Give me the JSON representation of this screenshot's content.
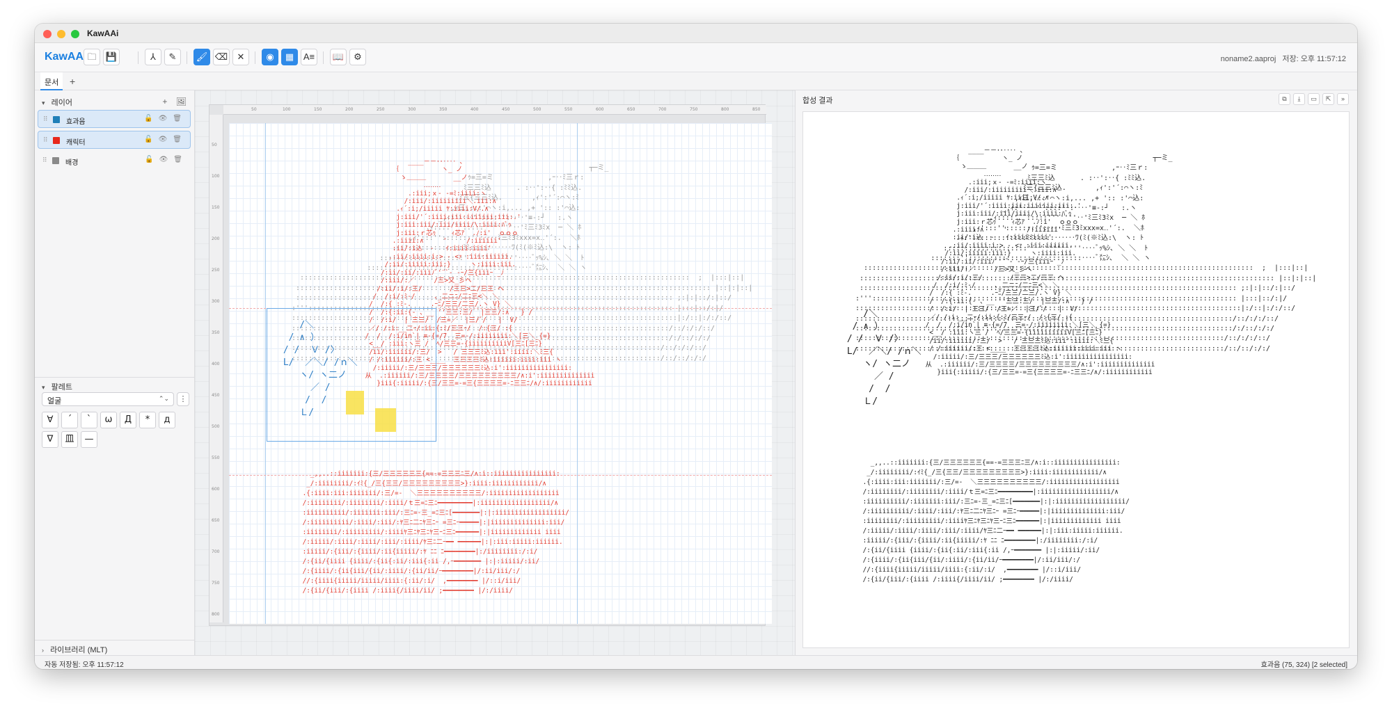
{
  "window": {
    "title": "KawAAi"
  },
  "toolbar": {
    "brand": "KawAAi",
    "buttons": [
      {
        "name": "open-folder-button",
        "icon": "folder-icon",
        "glyph": "🗀",
        "active": false
      },
      {
        "name": "save-button",
        "icon": "floppy-icon",
        "glyph": "💾",
        "active": false
      },
      {
        "name": "path-tool-button",
        "icon": "path-icon",
        "glyph": "⅄",
        "active": false
      },
      {
        "name": "pen-tool-button",
        "icon": "pen-icon",
        "glyph": "✎",
        "active": false
      },
      {
        "name": "brush-tool-button",
        "icon": "brush-icon",
        "glyph": "🖌",
        "active": true
      },
      {
        "name": "eraser-tool-button",
        "icon": "eraser-icon",
        "glyph": "⌫",
        "active": false
      },
      {
        "name": "clear-button",
        "icon": "close-icon",
        "glyph": "✕",
        "active": false
      },
      {
        "name": "snap-toggle-button",
        "icon": "magnet-icon",
        "glyph": "◉",
        "active": true
      },
      {
        "name": "grid-toggle-button",
        "icon": "grid-icon",
        "glyph": "▦",
        "active": true
      },
      {
        "name": "text-layout-button",
        "icon": "text-align-icon",
        "glyph": "A≡",
        "active": false
      },
      {
        "name": "book-button",
        "icon": "book-icon",
        "glyph": "📖",
        "active": false
      },
      {
        "name": "settings-button",
        "icon": "gear-icon",
        "glyph": "⚙",
        "active": false
      }
    ],
    "filename": "noname2.aaproj",
    "saved_status": "저장: 오후 11:57:12"
  },
  "tabs": {
    "doc_tab": "문서",
    "add_tab": "+"
  },
  "layers_panel": {
    "title": "레이어",
    "add_icon": "+",
    "image_icon": "🖼",
    "layers": [
      {
        "name": "효과음",
        "color": "#1f7fb8",
        "selected": true
      },
      {
        "name": "캐릭터",
        "color": "#e8281c",
        "selected": true
      },
      {
        "name": "배경",
        "color": "#8a8a8a",
        "selected": false
      }
    ],
    "layer_icons": {
      "lock": "🔓",
      "eye": "👁",
      "trash": "🗑"
    }
  },
  "palette_panel": {
    "title": "팔레트",
    "selected_set": "얼굴",
    "more_icon": "⋮",
    "glyphs": [
      "∀",
      "´",
      "`",
      "ω",
      "Д",
      "*",
      "д",
      "∇",
      "皿",
      "—"
    ]
  },
  "library_panel": {
    "title": "라이브러리 (MLT)"
  },
  "canvas": {
    "ruler_x": [
      "50",
      "100",
      "150",
      "200",
      "250",
      "300",
      "350",
      "400",
      "450",
      "500",
      "550",
      "600",
      "650",
      "700",
      "750",
      "800",
      "850"
    ],
    "ruler_y": [
      "50",
      "100",
      "150",
      "200",
      "250",
      "300",
      "350",
      "400",
      "450",
      "500",
      "550",
      "600",
      "650",
      "700",
      "750",
      "800"
    ],
    "effect_text": "    /＼\n  / ∧ ）\n / /  Ｖ /〉\n L/  ／＼/ /ｎ＼\n    ヽ/ ヽ二ノ\n      ／ /\n     /  /\n    Ｌ/",
    "character_text": "            ____－－･･‥‥ ､\n        ｛           ヽ_ ノ\n          ゝ＿＿＿       __ノ\n                ‥‥‥‥\n            .:iii;ｘ- -=ﾐ:iiii:ヽ\n           /:iii/:iiiiiiiii＼.iii:∧\n         .ｨ´:i;/iiiii ﾔ:iiii:V/.∧\n         j:iii/'´:iiii:iii:iiiiiii:iii:.'\n         j:iii:iii/:iii/iiii/\\:iiii:ﾊﾞｩ\n         j:iii:ｒ芯ｩ    ｨ芯ｱ  .ﾉ:i'  ｏｏｏ\n        .:iiii:∧     '     /:iiiiii'\n        :ii/:i込  -   ｲ:iiii:iiii'\n       .:ii/:iiii:i:> - <ｧ :iii:iiiiii.\n      /:ii/:iiiii:iii:}     ヽ:iiii:iii.\n     /:ii/:ii/:iiiﾉﾞ'¨ﾞ- -ｰ/三{iiiｰ _ﾉ\n     /:iii/:／     /三>又_彡ヘ\n    /:ii/:i/:三/       /三三>二/三三 ヘ\n   /  /:i/:ﾐ-/     ､_二ニﾆ/二ﾆ三<＼ ＼\n  /  /:{ :ﾐ-.     .ｰﾆ/三三/二三/.ヽ V} ＼\n  /  /:{:ii:{- 、__ ''三三:三/  |三三/:∧   } /\n  /  /:i/  | 三三/  /三=／  |三/ﾞ/   |  V/\n  ／/ /:i:__二ｰ/:ii:{:ﾐ/三三ｰ/  /:{三/ :{  \n /  /  /:i/in`| ≡-{=/7  三=-/:iiiiiiii:＼[三＼_{=}\n  <__/ :iii:ヽ三 /  ﾍ/三三=-{iiiiiiiiiiV[三ﾆ[三ﾆ}\n  /ii/:iiiiii/:三/  >   / 三三三ﾐ込:iii':iiii:＼ﾐ三{\n  / /:iiiiii/:三 <____  三三三三ﾐ込:iiiiii:iiii:iii ヽ\n   /:iiiii/:三/三三三/三三三三三三ﾐ込:i':iiiiiiiiiiiiiiii:\n 从  .:iiiiii/:三/三三三三/三三三三三三三三三/∧:i':iiiiiiiiiiiiii\n    }iii{:iiiii/:{三/三三=-=三{三三三三=-ﾆ三三ﾆ/∧/:iiiiiiiiiiii",
    "background_text": "                                                                       ┬─ミ_\n                                          ｩ=三=ミ             ,ｰ‥ﾐ三ｒ:\n                                         ﾐ三三ﾐ込      . :‥':‥{ :ﾐﾐ込.\n                                       .ﾐ三{三三ﾐ込.       ,ｨ':'´:⌒ヽ:ﾐ\n                                      ,ｨ三,:::'⌒ヽ:i,... ,+ ':: :'⌒込:\n                                   _,ｨ:'‥‥'´::::'':‥‥'≡-:┘   :.ヽ\n                                .ｨ::::'¨¨:::::'''''''‥'ﾐ三ﾐ3ﾐx  ─ ＼ ﾎ\n                            ,ｨ':::'':::::::'':‥‥ﾐ三ﾐ3ﾐxxx=x‥'´:.  ＼ﾎ\n                        .ｨ:':::::::::::::ﾐﾐ:::::‥‥‥ﾜ(ﾐ(※ﾐ込:\\  ヽ: ﾄ\n                     ::::::::::::::::::::'´ ''''''''''‥‥ﾞｯ%ｼ､ ＼ ＼  ﾄ\n                  :::::::'':::::::::::::::::::::::::::‥‥ﾞ㍍ｼ､  ＼ ＼ ヽ \n  :::::::::::::::::::::::::::::::::::::::::::::::::::::::::::::::::::::::::::::::::::::::::::::  ;  |:::|::|\n ::::::::::::::::::::::::::::::::::::::::::::::::::::::::::::::::::::::::::::::::::::::::::::::::::: |::|:|::|\n :::::::::::::::::::::::::::::::::::::::::::::::::::::::::::::::::::::::::::::::::::::::::: ;:|:|::/:|::/\n:'''::::::::::::::::::::::::::::::::::::::::::::::::::::::::::::::::::::::::::::::::::::::: |:::|::/:|/\n::::::::::::::::::::::::::::::::::::::::::::::::::::::::::::::::::::::::::::::::::::::::::::|:/::|:/:/::/\n::::::::::::::::::::::::::::::::::::::::::::::::::::::::::::::::::::::::::::::::::::::::::/::/:/:/::/\n::::::::::::::::::::::::::::::::::::::::::::::::::::::::::::::::::::::::::::::::::::::::::/:/::/:/:/\n::::::::::::::::::::::::::::::::::::::::::::::::::::::::::::::::::::::::::::::::::::::::/::/:/:/::/\n::::::::::::::::::::::::::::::::::::::::::::::::::::::::::::::::::::::::::::::::::::::::/::/::/:/:/",
    "lower_red_text": "   _,,..::iiiiiii:{三/三三三三三三{==-=三三三ﾆ三/∧:i::iiiiiiiiiiiiiiii:\n  _/:iiiiiiii/:ｲﾐ{_/三{三三/三三三三三三三三三>}:iiii:iiiiiiiiiiii/∧\n .{:iiii:iii:iiiiiii/:三/=-  ＼三三三三三三三三三三/:iiiiiiiiiiiiiiiiii\n /:iiiiiiii/:iiiiiiii/:iiii/ｔ三=ﾆ三ﾆ━━━━━━━━━|:iiiiiiiiiiiiiiiiii/∧\n :iiiiiiiiii/:iiiiiii:iii/:三ﾆ=-三_=ﾆ三ﾆ[━━━━━━━|:|:iiiiiiiiiiiiiiiiii/\n /:iiiiiiiiii/:iiii/:iii/:ﾔ三ﾆ二ﾆﾔ三ﾆｰ =三ﾆｰ━━━━━|:|iiiiiiiiiiiiii:iii/\n :iiiiiiii/:iiiiiiiii/:iiiiﾔ三ﾆﾔ三ﾆﾔ三ｰﾆ三ﾆ━━━━━━|:|iiiiiiiiiiiii iiii\n /:iiiii/:iiii/:iiii/:iii/:iiii/ﾔ三ﾆ二ｰ━━ ━━━━━━|:|:iii:iiiii:iiiiii.\n :iiiii/:{iii/:{iiii/:ii{iiiii/:ﾔ ﾆﾆ ﾆ━━━━━━━━|:/iiiiiiii:/:i/\n /:{ii/{iiii {iiii/:{ii{:ii/:iii{:ii /,ｰ━━━━━━━ |:|:iiiii/:ii/\n /:{iiii/:{ii{iii/{ii/:iiii/:{ii/ii/ｰ━━━━━━━━|/:ii/iii/:/\n //:{iiii{iiiii/iiiii/iiii:{:ii/:i/  ,━━━━━━━━ |/::i/iii/\n /:{ii/{iii/:{iiii /:iiii{/iiii/ii/ ;━━━━━━━━ |/:/iiii/"
  },
  "result_panel": {
    "title": "합성 결과",
    "icons": [
      "⧉",
      "⤓",
      "▭",
      "⇱",
      "»"
    ]
  },
  "statusbar": {
    "left": "자동 저장됨: 오후 11:57:12",
    "right": "효과음 (75, 324) [2 selected]"
  },
  "colors": {
    "accent": "#2f8ae8",
    "brand": "#1a7fe0",
    "character_red": "#e23a2e",
    "effect_blue": "#2f7fc6",
    "background_gray": "#9a9a9a",
    "highlight_yellow": "#f8df45"
  }
}
